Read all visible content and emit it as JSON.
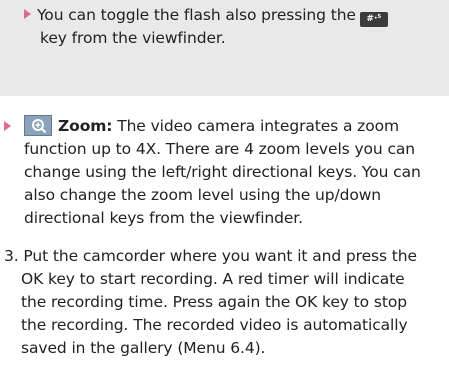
{
  "note": {
    "line1_prefix": "You can toggle the flash also pressing the",
    "key_label": "#·⁵",
    "line2": "key from the viewfinder."
  },
  "zoom": {
    "title": "Zoom:",
    "lines": [
      "The video camera integrates a zoom",
      "function up to 4X. There are 4 zoom levels you can",
      "change using the left/right directional keys. You can",
      "also change the zoom level using the up/down",
      "directional keys from the viewfinder."
    ]
  },
  "step3": {
    "lines": [
      "3. Put the camcorder where you want it and press the",
      "OK key to start recording. A red timer will indicate",
      "the recording time. Press again the OK key to stop",
      "the recording. The recorded video is automatically",
      "saved in the gallery (Menu 6.4)."
    ]
  },
  "colors": {
    "note_background": "#e9e9e9",
    "bullet": "#e06a8a",
    "icon_background": "#8aa3b8"
  },
  "icons": {
    "key": "flash-key-icon",
    "zoom": "zoom-magnifier-icon",
    "bullet": "triangle-bullet-icon"
  }
}
